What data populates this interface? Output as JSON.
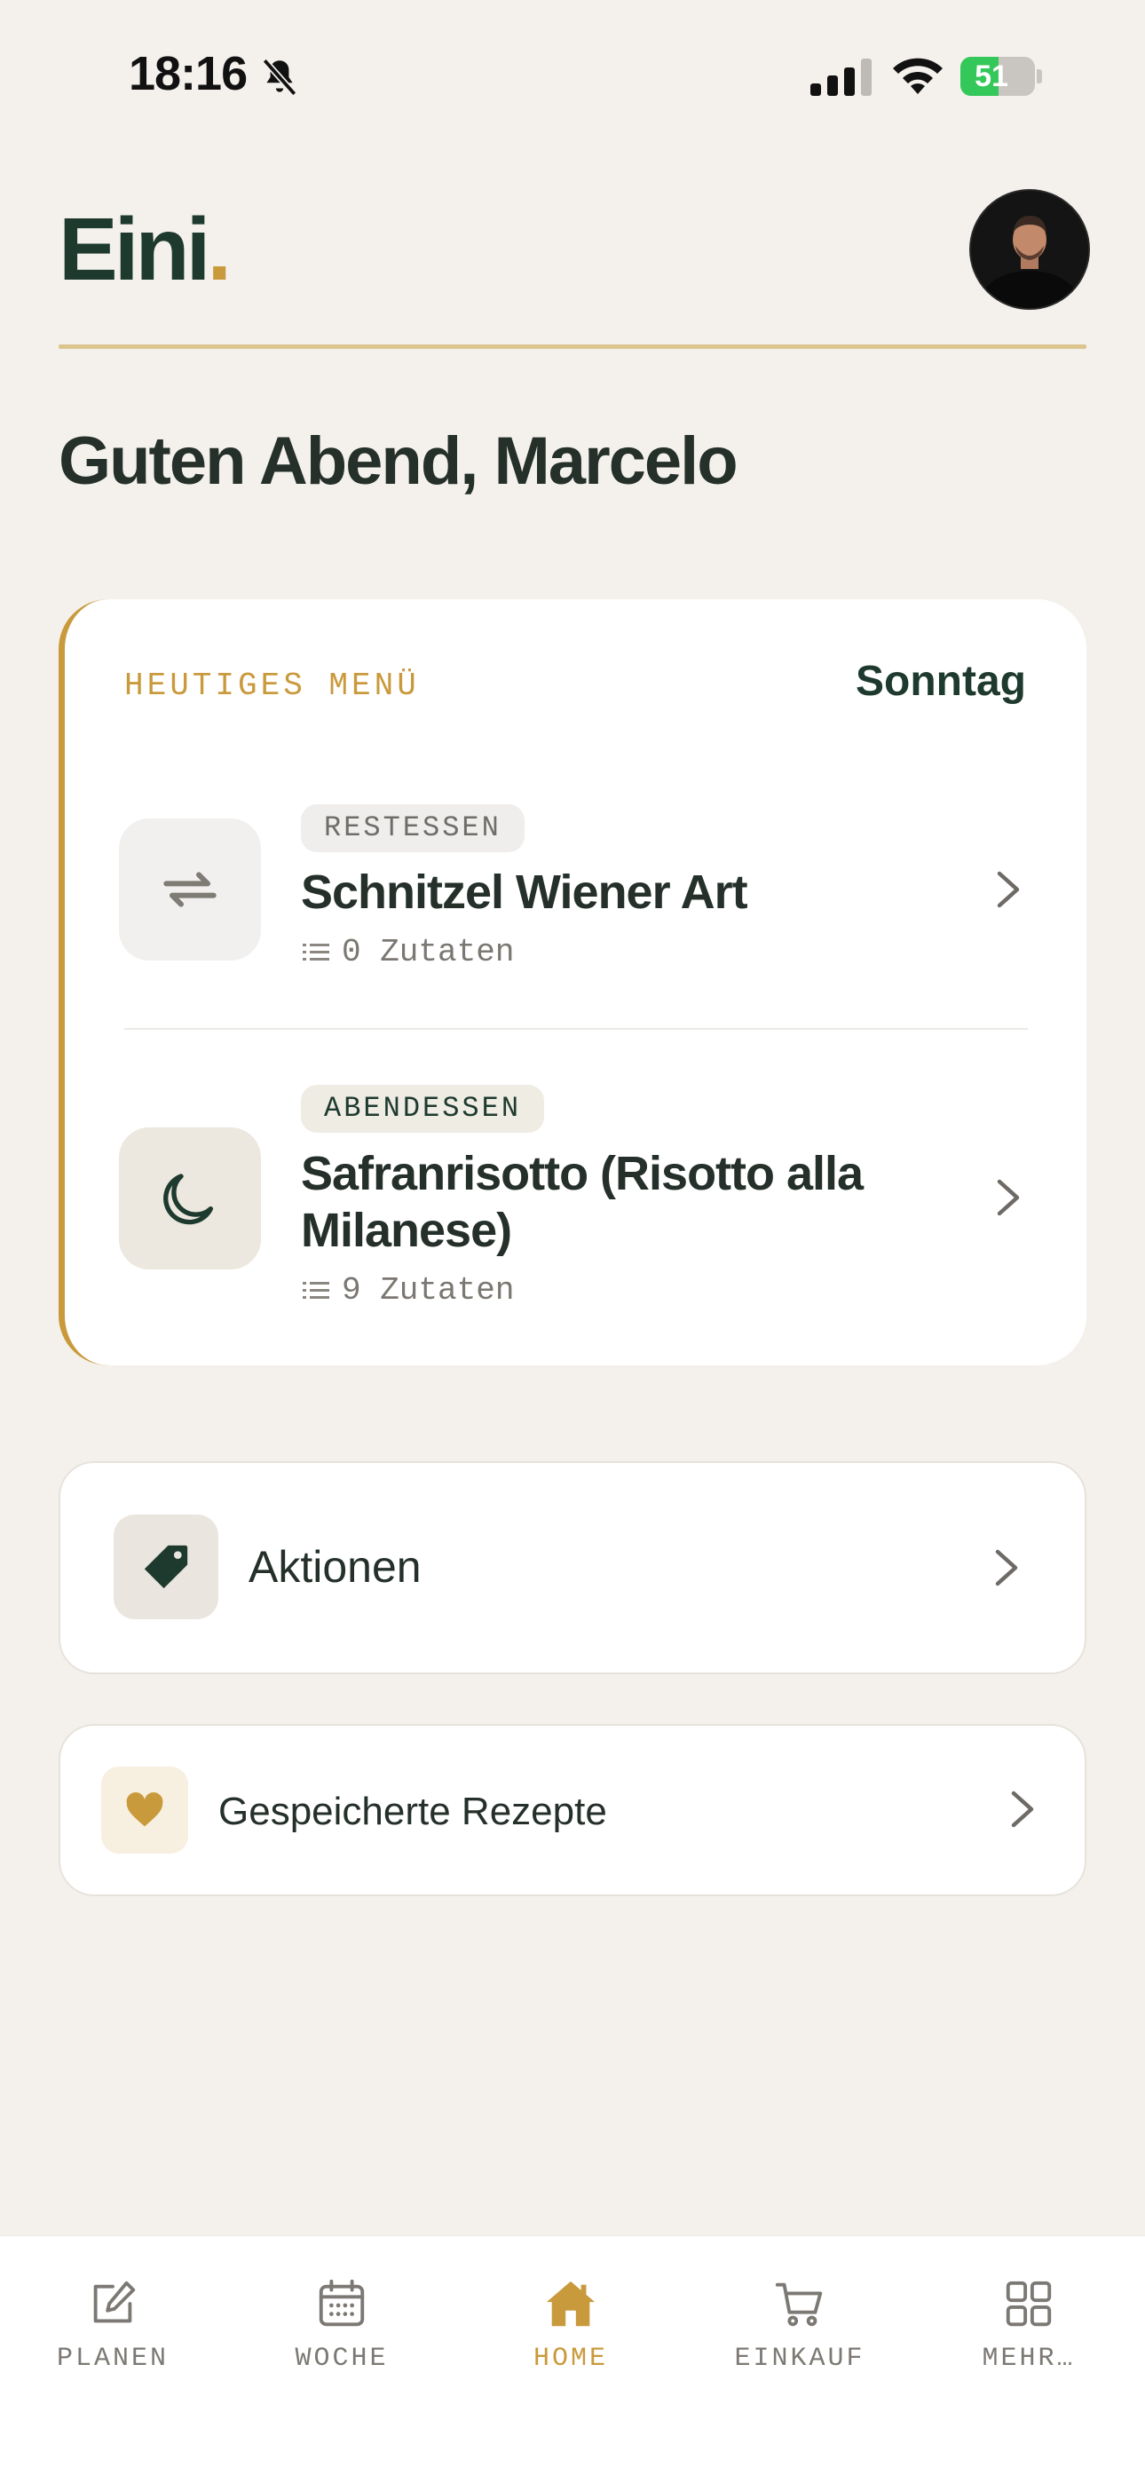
{
  "status_bar": {
    "time": "18:16",
    "battery_percent": "51",
    "battery_level": 0.51,
    "icons": [
      "bell-slash-icon",
      "cellular-signal-icon",
      "wifi-icon",
      "battery-charging-icon"
    ]
  },
  "header": {
    "logo_text": "Eini",
    "logo_dot": ".",
    "avatar": "user-avatar"
  },
  "greeting": "Guten Abend, Marcelo",
  "today_menu": {
    "label": "HEUTIGES MENÜ",
    "day": "Sonntag",
    "meals": [
      {
        "badge": "RESTESSEN",
        "title": "Schnitzel Wiener Art",
        "ingredients": "0 Zutaten",
        "icon": "repeat-icon"
      },
      {
        "badge": "ABENDESSEN",
        "title": "Safranrisotto (Risotto alla Milanese)",
        "ingredients": "9 Zutaten",
        "icon": "moon-icon"
      }
    ]
  },
  "actions": {
    "label": "Aktionen",
    "icon": "tag-icon"
  },
  "saved_recipes": {
    "label": "Gespeicherte Rezepte",
    "icon": "heart-icon"
  },
  "tabbar": {
    "tabs": [
      {
        "label": "PLANEN",
        "icon": "edit-icon"
      },
      {
        "label": "WOCHE",
        "icon": "calendar-icon"
      },
      {
        "label": "HOME",
        "icon": "home-icon",
        "active": true
      },
      {
        "label": "EINKAUF",
        "icon": "cart-icon"
      },
      {
        "label": "MEHR…",
        "icon": "grid-icon"
      }
    ]
  },
  "colors": {
    "background": "#F4F1EC",
    "accent_gold": "#C99A3C",
    "brand_green": "#1E3A2E",
    "battery_green": "#34C759"
  }
}
